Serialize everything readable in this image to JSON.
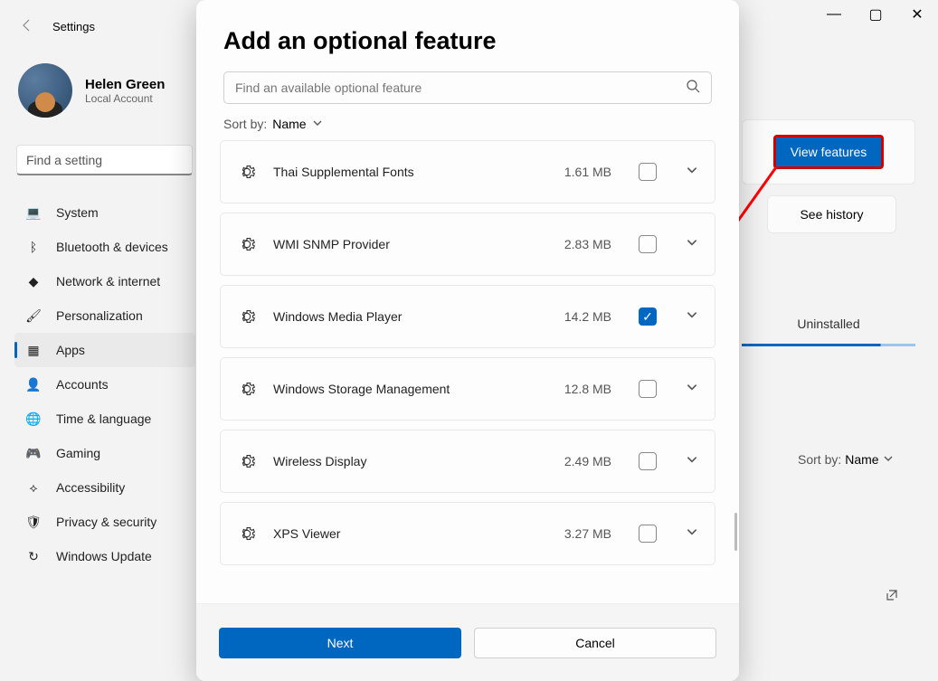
{
  "header": {
    "app_title": "Settings"
  },
  "window_controls": {
    "min": "—",
    "max": "▢",
    "close": "✕"
  },
  "user": {
    "name": "Helen Green",
    "sub": "Local Account"
  },
  "sidebar": {
    "search_placeholder": "Find a setting",
    "items": [
      {
        "icon": "💻",
        "label": "System",
        "selected": false
      },
      {
        "icon": "ᛒ",
        "label": "Bluetooth & devices",
        "selected": false
      },
      {
        "icon": "◆",
        "label": "Network & internet",
        "selected": false
      },
      {
        "icon": "🖌",
        "label": "Personalization",
        "selected": false
      },
      {
        "icon": "▦",
        "label": "Apps",
        "selected": true
      },
      {
        "icon": "👤",
        "label": "Accounts",
        "selected": false
      },
      {
        "icon": "🌐",
        "label": "Time & language",
        "selected": false
      },
      {
        "icon": "🎮",
        "label": "Gaming",
        "selected": false
      },
      {
        "icon": "⟡",
        "label": "Accessibility",
        "selected": false
      },
      {
        "icon": "🛡",
        "label": "Privacy & security",
        "selected": false
      },
      {
        "icon": "↻",
        "label": "Windows Update",
        "selected": false
      }
    ]
  },
  "background": {
    "view_features": "View features",
    "see_history": "See history",
    "uninstalled_tab": "Uninstalled",
    "sort_label": "Sort by:",
    "sort_value": "Name"
  },
  "modal": {
    "title": "Add an optional feature",
    "search_placeholder": "Find an available optional feature",
    "sort_label": "Sort by:",
    "sort_value": "Name",
    "features": [
      {
        "name": "Thai Supplemental Fonts",
        "size": "1.61 MB",
        "checked": false
      },
      {
        "name": "WMI SNMP Provider",
        "size": "2.83 MB",
        "checked": false
      },
      {
        "name": "Windows Media Player",
        "size": "14.2 MB",
        "checked": true
      },
      {
        "name": "Windows Storage Management",
        "size": "12.8 MB",
        "checked": false
      },
      {
        "name": "Wireless Display",
        "size": "2.49 MB",
        "checked": false
      },
      {
        "name": "XPS Viewer",
        "size": "3.27 MB",
        "checked": false
      }
    ],
    "next": "Next",
    "cancel": "Cancel"
  }
}
